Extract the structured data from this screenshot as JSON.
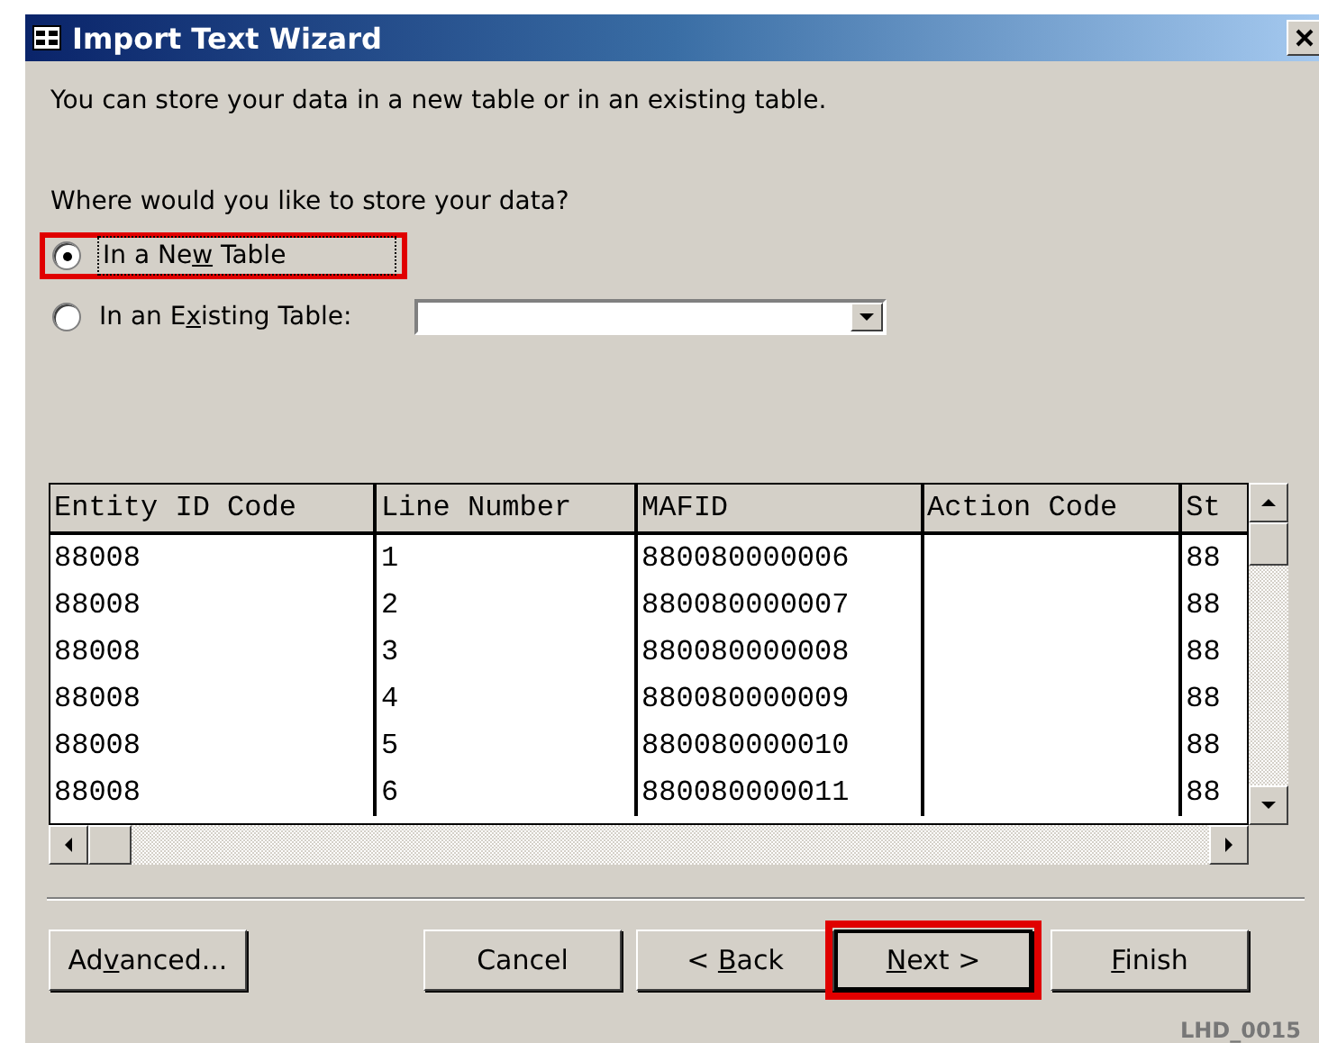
{
  "window": {
    "title": "Import Text Wizard"
  },
  "intro": "You can store your data in a new table or in an existing table.",
  "question": "Where would you like to store your data?",
  "options": [
    {
      "label_parts": [
        {
          "text": "In a Ne",
          "access_key": false
        },
        {
          "text": "w",
          "access_key": true
        },
        {
          "text": " Table",
          "access_key": false
        }
      ],
      "selected": true,
      "highlighted": true,
      "kind": "plain"
    },
    {
      "label_parts": [
        {
          "text": "In an E",
          "access_key": false
        },
        {
          "text": "x",
          "access_key": true
        },
        {
          "text": "isting Table:",
          "access_key": false
        }
      ],
      "selected": false,
      "highlighted": false,
      "kind": "with-dropdown"
    }
  ],
  "table": {
    "columns": [
      "Entity ID Code",
      "Line Number",
      "MAFID",
      "Action Code",
      "St"
    ],
    "rows": [
      [
        "88008",
        "1",
        "880080000006",
        null,
        "88"
      ],
      [
        "88008",
        "2",
        "880080000007",
        null,
        "88"
      ],
      [
        "88008",
        "3",
        "880080000008",
        null,
        "88"
      ],
      [
        "88008",
        "4",
        "880080000009",
        null,
        "88"
      ],
      [
        "88008",
        "5",
        "880080000010",
        null,
        "88"
      ],
      [
        "88008",
        "6",
        "880080000011",
        null,
        "88"
      ]
    ]
  },
  "buttons": [
    {
      "label_parts": [
        {
          "text": "Ad",
          "access_key": false
        },
        {
          "text": "v",
          "access_key": true
        },
        {
          "text": "anced...",
          "access_key": false
        }
      ],
      "highlighted": false
    },
    {
      "label_parts": [
        {
          "text": "Cancel",
          "access_key": false
        }
      ],
      "highlighted": false
    },
    {
      "label_parts": [
        {
          "text": "< ",
          "access_key": false
        },
        {
          "text": "B",
          "access_key": true
        },
        {
          "text": "ack",
          "access_key": false
        }
      ],
      "highlighted": false
    },
    {
      "label_parts": [
        {
          "text": "N",
          "access_key": true
        },
        {
          "text": "ext >",
          "access_key": false
        }
      ],
      "highlighted": true
    },
    {
      "label_parts": [
        {
          "text": "F",
          "access_key": true
        },
        {
          "text": "inish",
          "access_key": false
        }
      ],
      "highlighted": false
    }
  ],
  "document_id": "LHD_0015"
}
